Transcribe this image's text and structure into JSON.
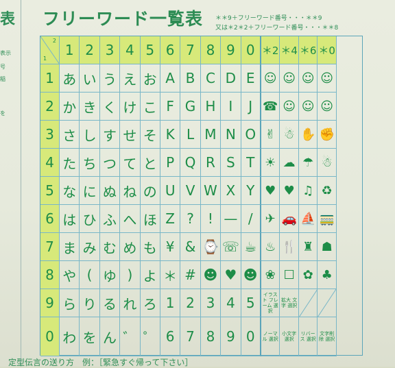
{
  "left_strip": {
    "title": "表",
    "lines": [
      "表示",
      "号",
      "稲",
      "を"
    ]
  },
  "title": "フリーワード一覧表",
  "notes": [
    "＊＊9＋フリーワード番号・・・＊＊9",
    "又は＊2＊2＋フリーワード番号・・・＊＊8"
  ],
  "table": {
    "corner": [
      "2",
      "1"
    ],
    "col_headers": [
      "1",
      "2",
      "3",
      "4",
      "5",
      "6",
      "7",
      "8",
      "9",
      "0",
      "＊2",
      "＊4",
      "＊6",
      "＊0"
    ],
    "rows": [
      {
        "num": "1",
        "cells": [
          "あ",
          "い",
          "う",
          "え",
          "お",
          "A",
          "B",
          "C",
          "D",
          "E",
          "☺",
          "☺",
          "☺",
          "☺"
        ]
      },
      {
        "num": "2",
        "cells": [
          "か",
          "き",
          "く",
          "け",
          "こ",
          "F",
          "G",
          "H",
          "I",
          "J",
          "☎",
          "☺",
          "☺",
          "☺"
        ]
      },
      {
        "num": "3",
        "cells": [
          "さ",
          "し",
          "す",
          "せ",
          "そ",
          "K",
          "L",
          "M",
          "N",
          "O",
          "✌",
          "☃",
          "✋",
          "✊"
        ]
      },
      {
        "num": "4",
        "cells": [
          "た",
          "ち",
          "つ",
          "て",
          "と",
          "P",
          "Q",
          "R",
          "S",
          "T",
          "☀",
          "☁",
          "☂",
          "☃"
        ]
      },
      {
        "num": "5",
        "cells": [
          "な",
          "に",
          "ぬ",
          "ね",
          "の",
          "U",
          "V",
          "W",
          "X",
          "Y",
          "♥",
          "♥",
          "♫",
          "♻"
        ]
      },
      {
        "num": "6",
        "cells": [
          "は",
          "ひ",
          "ふ",
          "へ",
          "ほ",
          "Z",
          "?",
          "!",
          "—",
          "/",
          "✈",
          "🚗",
          "⛵",
          "🚃"
        ]
      },
      {
        "num": "7",
        "cells": [
          "ま",
          "み",
          "む",
          "め",
          "も",
          "¥",
          "&",
          "⌚",
          "☏",
          "☕",
          "♨",
          "🍴",
          "♜",
          "☗"
        ]
      },
      {
        "num": "8",
        "cells": [
          "や",
          "(",
          "ゆ",
          ")",
          "よ",
          "＊",
          "#",
          "☻",
          "♥",
          "☻",
          "❀",
          "☐",
          "✿",
          "♣"
        ]
      },
      {
        "num": "9",
        "cells": [
          "ら",
          "り",
          "る",
          "れ",
          "ろ",
          "1",
          "2",
          "3",
          "4",
          "5",
          "イラスト フレーム 選択",
          "拡大 文字 選択",
          "",
          ""
        ]
      },
      {
        "num": "0",
        "cells": [
          "わ",
          "を",
          "ん",
          "゛",
          "゜",
          "6",
          "7",
          "8",
          "9",
          "0",
          "ノーマル 選択",
          "小文字 選択",
          "リバース 選択",
          "文字削除 選択"
        ]
      }
    ]
  },
  "bottom_text": "定型伝言の送り方　例：［緊急すぐ帰って下さい］"
}
